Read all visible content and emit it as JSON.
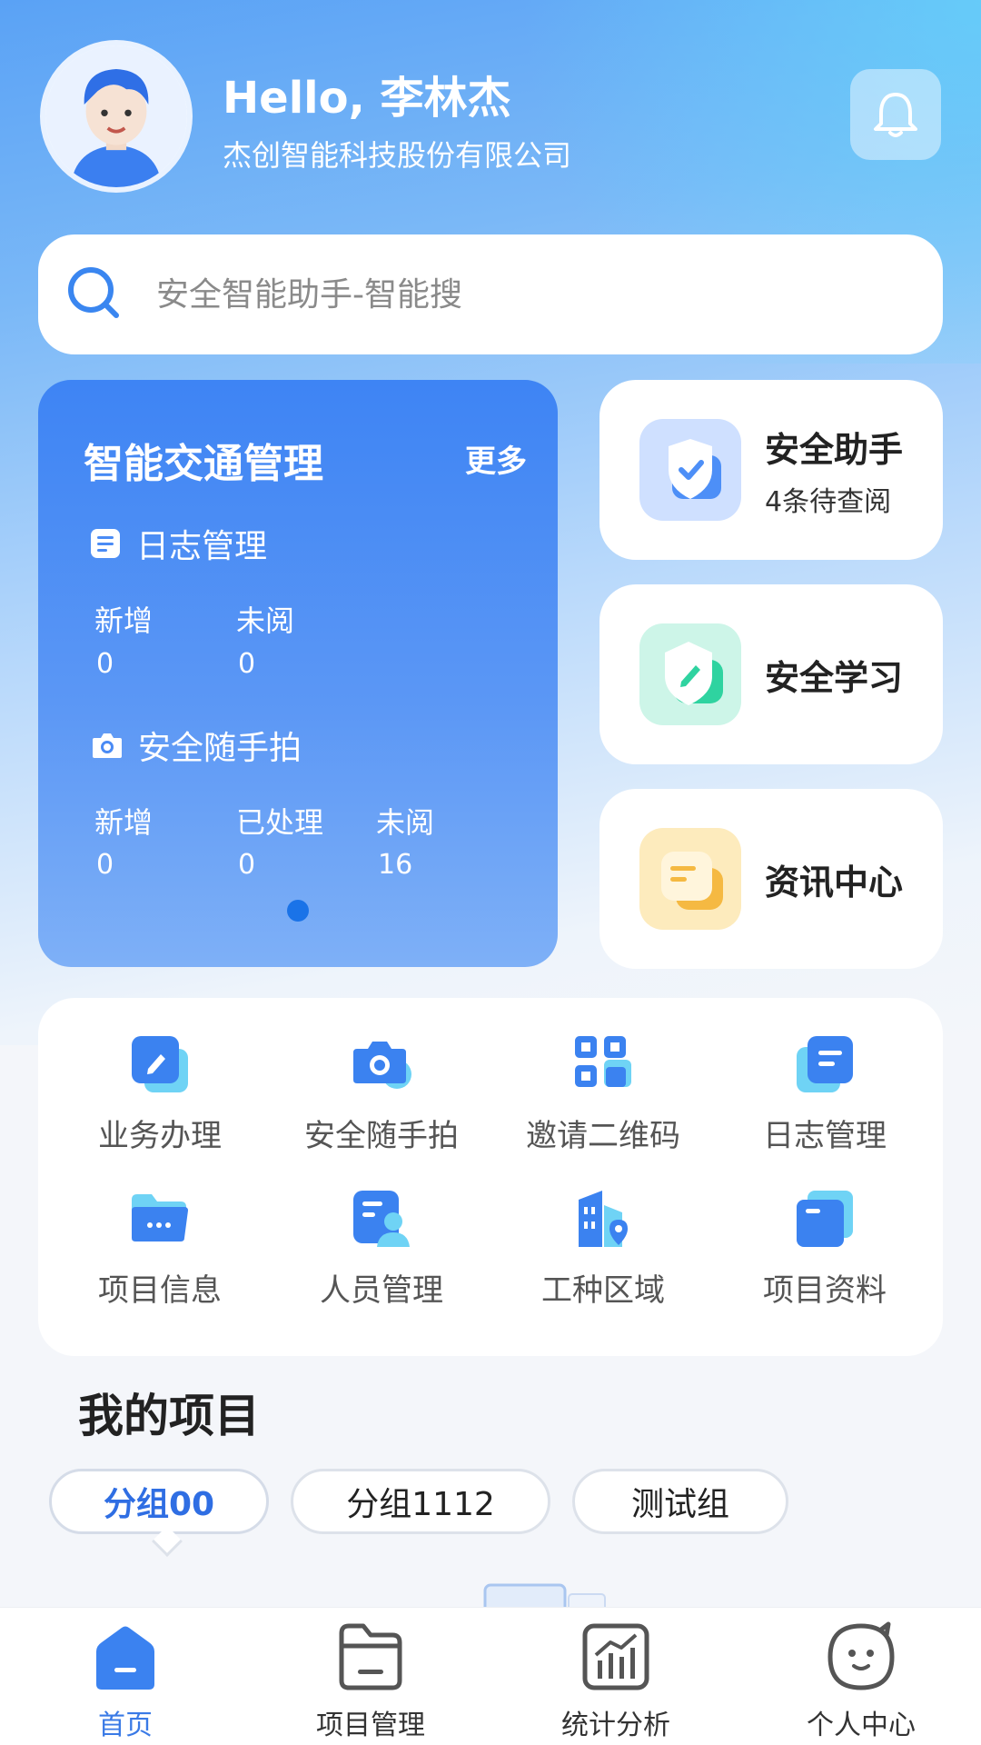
{
  "header": {
    "greeting": "Hello, 李林杰",
    "company": "杰创智能科技股份有限公司"
  },
  "search": {
    "placeholder": "安全智能助手-智能搜"
  },
  "traffic_card": {
    "title": "智能交通管理",
    "more": "更多",
    "log_section": {
      "title": "日志管理",
      "stats": [
        {
          "label": "新增",
          "value": "0"
        },
        {
          "label": "未阅",
          "value": "0"
        }
      ]
    },
    "photo_section": {
      "title": "安全随手拍",
      "stats": [
        {
          "label": "新增",
          "value": "0"
        },
        {
          "label": "已处理",
          "value": "0"
        },
        {
          "label": "未阅",
          "value": "16"
        }
      ]
    }
  },
  "side_cards": [
    {
      "title": "安全助手",
      "subtitle": "4条待查阅",
      "icon": "shield-check-icon"
    },
    {
      "title": "安全学习",
      "subtitle": "",
      "icon": "shield-pencil-icon"
    },
    {
      "title": "资讯中心",
      "subtitle": "",
      "icon": "news-icon"
    }
  ],
  "quick_grid": [
    {
      "label": "业务办理",
      "icon": "edit-icon"
    },
    {
      "label": "安全随手拍",
      "icon": "camera-icon"
    },
    {
      "label": "邀请二维码",
      "icon": "qrcode-icon"
    },
    {
      "label": "日志管理",
      "icon": "log-icon"
    },
    {
      "label": "项目信息",
      "icon": "folder-icon"
    },
    {
      "label": "人员管理",
      "icon": "people-icon"
    },
    {
      "label": "工种区域",
      "icon": "building-location-icon"
    },
    {
      "label": "项目资料",
      "icon": "docs-icon"
    }
  ],
  "my_projects": {
    "title": "我的项目",
    "groups": [
      "分组00",
      "分组1112",
      "测试组"
    ],
    "selected": "分组00"
  },
  "tabbar": [
    {
      "label": "首页",
      "icon": "home-icon",
      "active": true
    },
    {
      "label": "项目管理",
      "icon": "project-folder-icon",
      "active": false
    },
    {
      "label": "统计分析",
      "icon": "chart-icon",
      "active": false
    },
    {
      "label": "个人中心",
      "icon": "profile-face-icon",
      "active": false
    }
  ],
  "colors": {
    "primary": "#3e84f4",
    "accent_green": "#2fd3a0",
    "accent_yellow": "#f5b942"
  }
}
